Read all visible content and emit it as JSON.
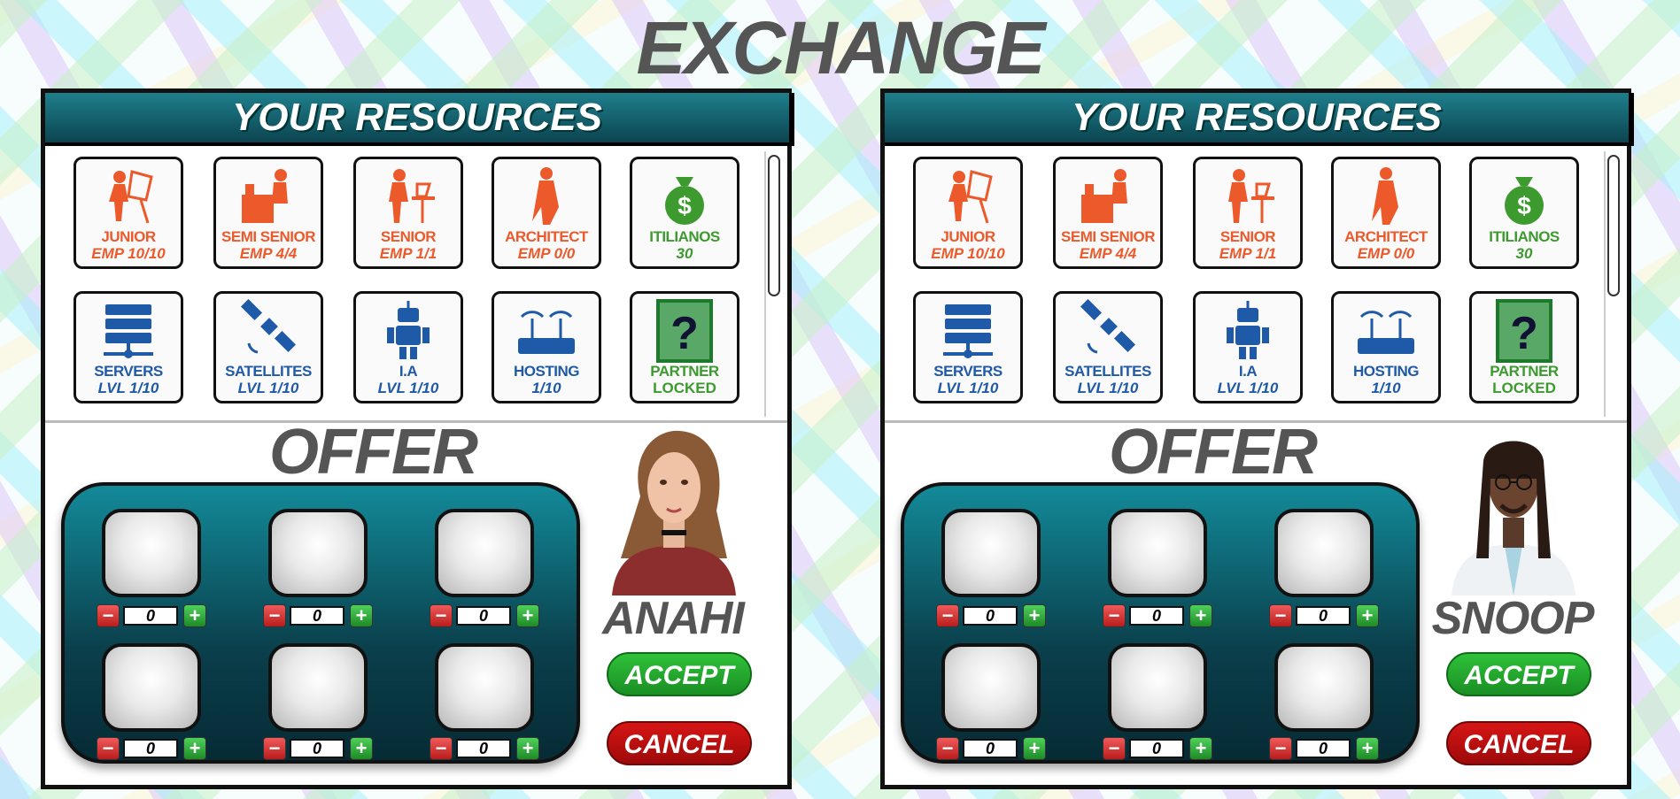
{
  "title": "EXCHANGE",
  "panels": [
    {
      "header": "YOUR RESOURCES",
      "resources": [
        {
          "name": "JUNIOR",
          "value": "EMP 10/10",
          "icon": "designer-icon"
        },
        {
          "name": "SEMI SENIOR",
          "value": "EMP 4/4",
          "icon": "desk-worker-icon"
        },
        {
          "name": "SENIOR",
          "value": "EMP 1/1",
          "icon": "laptop-worker-icon"
        },
        {
          "name": "ARCHITECT",
          "value": "EMP 0/0",
          "icon": "architect-icon"
        },
        {
          "name": "ITILIANOS",
          "value": "30",
          "icon": "money-bag-icon"
        },
        {
          "name": "SERVERS",
          "value": "LVL 1/10",
          "icon": "server-icon"
        },
        {
          "name": "SATELLITES",
          "value": "LVL 1/10",
          "icon": "satellite-icon"
        },
        {
          "name": "I.A",
          "value": "LVL 1/10",
          "icon": "robot-icon"
        },
        {
          "name": "HOSTING",
          "value": "1/10",
          "icon": "router-icon"
        },
        {
          "name": "PARTNER",
          "value": "LOCKED",
          "icon": "question-mark-icon"
        }
      ],
      "offer_title": "OFFER",
      "slots": [
        "0",
        "0",
        "0",
        "0",
        "0",
        "0"
      ],
      "character_name": "ANAHI",
      "accept_label": "ACCEPT",
      "cancel_label": "CANCEL"
    },
    {
      "header": "YOUR RESOURCES",
      "resources": [
        {
          "name": "JUNIOR",
          "value": "EMP 10/10",
          "icon": "designer-icon"
        },
        {
          "name": "SEMI SENIOR",
          "value": "EMP 4/4",
          "icon": "desk-worker-icon"
        },
        {
          "name": "SENIOR",
          "value": "EMP 1/1",
          "icon": "laptop-worker-icon"
        },
        {
          "name": "ARCHITECT",
          "value": "EMP 0/0",
          "icon": "architect-icon"
        },
        {
          "name": "ITILIANOS",
          "value": "30",
          "icon": "money-bag-icon"
        },
        {
          "name": "SERVERS",
          "value": "LVL 1/10",
          "icon": "server-icon"
        },
        {
          "name": "SATELLITES",
          "value": "LVL 1/10",
          "icon": "satellite-icon"
        },
        {
          "name": "I.A",
          "value": "LVL 1/10",
          "icon": "robot-icon"
        },
        {
          "name": "HOSTING",
          "value": "1/10",
          "icon": "router-icon"
        },
        {
          "name": "PARTNER",
          "value": "LOCKED",
          "icon": "question-mark-icon"
        }
      ],
      "offer_title": "OFFER",
      "slots": [
        "0",
        "0",
        "0",
        "0",
        "0",
        "0"
      ],
      "character_name": "SNOOP",
      "accept_label": "ACCEPT",
      "cancel_label": "CANCEL"
    }
  ],
  "colors": {
    "employee_text": "#ec5a2c",
    "level_text": "#1f5aa8",
    "currency_text": "#3c9a2e",
    "accept": "#22a52d",
    "cancel": "#c10d0d",
    "teal": "#0b4450"
  }
}
